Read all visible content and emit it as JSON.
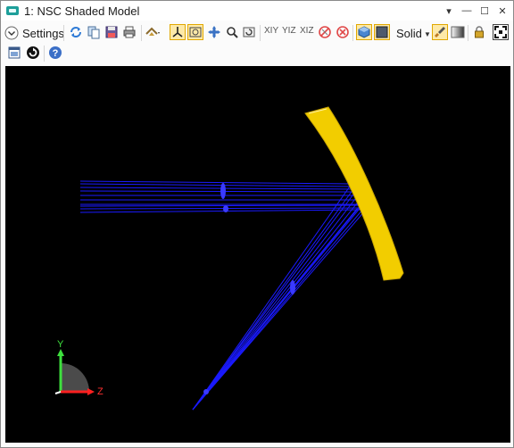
{
  "window": {
    "title": "1: NSC Shaded Model",
    "controls": {
      "dropdown": "▾",
      "minimize": "—",
      "maximize": "☐",
      "close": "✕"
    }
  },
  "toolbar": {
    "settings_label": "Settings",
    "axis_views": [
      "XIY",
      "YIZ",
      "XIZ"
    ],
    "solid_label": "Solid",
    "active_color": "#fde9a8"
  },
  "viewport": {
    "background": "#000000",
    "ray_color": "#1a1aff",
    "mirror_color": "#f2cd00",
    "triad_labels": {
      "y": "Y",
      "z": "Z"
    }
  }
}
